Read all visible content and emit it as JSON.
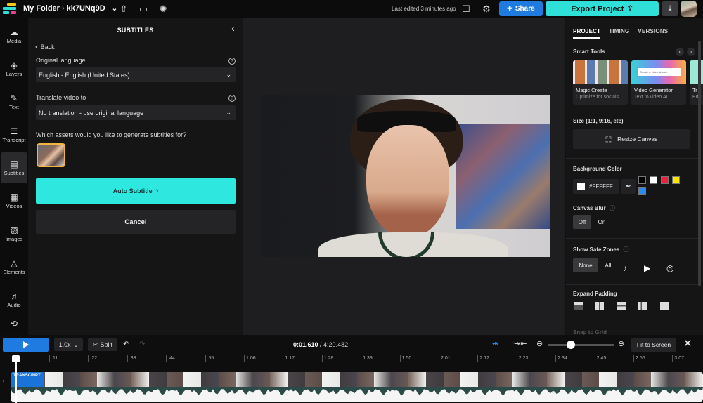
{
  "topbar": {
    "folder": "My Folder",
    "separator": "›",
    "project_name": "kk7UNq9D",
    "last_edited": "Last edited 3 minutes ago",
    "share_label": "Share",
    "export_label": "Export Project",
    "icons": {
      "upload": "⇧",
      "captions": "▭",
      "idea": "💡",
      "comment": "☐",
      "settings": "⚙",
      "download": "⤓",
      "share_person": "👤",
      "chevron": "⌄"
    }
  },
  "rail": {
    "items": [
      {
        "label": "Media",
        "icon": "☁"
      },
      {
        "label": "Layers",
        "icon": "◈"
      },
      {
        "label": "Text",
        "icon": "✎"
      },
      {
        "label": "Transcript",
        "icon": "☰"
      },
      {
        "label": "Subtitles",
        "icon": "▤"
      },
      {
        "label": "Videos",
        "icon": "▦"
      },
      {
        "label": "Images",
        "icon": "▧"
      },
      {
        "label": "Elements",
        "icon": "△"
      },
      {
        "label": "Audio",
        "icon": "♫"
      },
      {
        "label": "",
        "icon": "⟲"
      }
    ],
    "active": "Subtitles"
  },
  "subtitles_panel": {
    "title": "SUBTITLES",
    "back_label": "Back",
    "original_language_label": "Original language",
    "original_language_value": "English - English (United States)",
    "translate_label": "Translate video to",
    "translate_value": "No translation - use original language",
    "assets_question": "Which assets would you like to generate subtitles for?",
    "auto_subtitle_label": "Auto Subtitle",
    "cancel_label": "Cancel",
    "help_glyph": "?",
    "chevron_glyph": "⌄",
    "back_glyph": "‹",
    "collapse_glyph": "‹",
    "next_glyph": "›"
  },
  "right_panel": {
    "tabs": [
      {
        "label": "PROJECT",
        "active": true
      },
      {
        "label": "TIMING",
        "active": false
      },
      {
        "label": "VERSIONS",
        "active": false
      }
    ],
    "smart_tools_title": "Smart Tools",
    "smart_tools": [
      {
        "name": "Magic Create",
        "desc": "Optimize for socials"
      },
      {
        "name": "Video Generator",
        "desc": "Text to video AI",
        "thumb_text": "Create a video about..."
      },
      {
        "name": "Tr",
        "desc": "Ed"
      }
    ],
    "size_title": "Size (1:1, 9:16, etc)",
    "resize_label": "Resize Canvas",
    "bg_color_title": "Background Color",
    "bg_color_value": "#FFFFFF",
    "swatches": [
      "#000000",
      "#FFFFFF",
      "#E8213F",
      "#FFE600",
      "#2A8CF0"
    ],
    "canvas_blur_title": "Canvas Blur",
    "canvas_blur_options": [
      "Off",
      "On"
    ],
    "canvas_blur_selected": "Off",
    "safe_zones_title": "Show Safe Zones",
    "safe_zones_options": [
      "None",
      "All"
    ],
    "safe_zones_selected": "None",
    "safe_zone_icons": [
      "tiktok-icon",
      "youtube-icon",
      "instagram-icon"
    ],
    "expand_padding_title": "Expand Padding",
    "snap_title": "Snap to Grid"
  },
  "timeline": {
    "speed": "1.0x",
    "split_label": "Split",
    "current_time": "0:01.610",
    "total_time": "4:20.482",
    "time_separator": " / ",
    "fit_label": "Fit to Screen",
    "zoom_level": 0.35,
    "ticks": [
      ":11",
      ":22",
      ":33",
      ":44",
      ":55",
      "1:06",
      "1:17",
      "1:28",
      "1:39",
      "1:50",
      "2:01",
      "2:12",
      "2:23",
      "2:34",
      "2:45",
      "2:56",
      "3:07"
    ],
    "track_number": "1",
    "track_label": "TRANSCRIPT"
  }
}
